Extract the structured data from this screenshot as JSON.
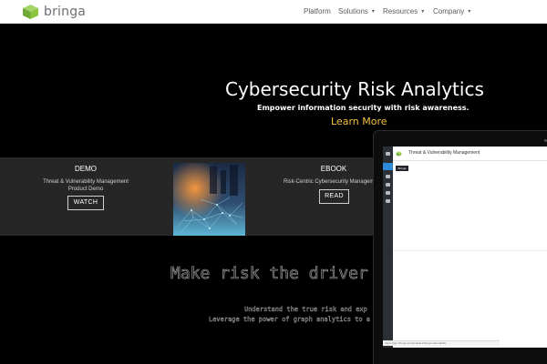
{
  "nav": {
    "logo_text": "bringa",
    "items": [
      {
        "label": "Platform",
        "has_caret": false
      },
      {
        "label": "Solutions",
        "has_caret": true
      },
      {
        "label": "Resources",
        "has_caret": true
      },
      {
        "label": "Company",
        "has_caret": true
      }
    ],
    "caret_glyph": "▾"
  },
  "hero": {
    "title": "Cybersecurity Risk Analytics",
    "subtitle": "Empower information security with risk awareness.",
    "cta": "Learn More",
    "cta_color": "#f5c242"
  },
  "resources": [
    {
      "type": "DEMO",
      "description_line1": "Threat & Vulnerability Management",
      "description_line2": "Product Demo",
      "button": "WATCH"
    },
    {
      "type": "EBOOK",
      "description_line1": "Risk-Centric Cybersecurity Management",
      "description_line2": "",
      "button": "READ"
    }
  ],
  "secondary": {
    "heading": "Make risk the driver for",
    "line1": "Understand the true risk and exp",
    "line2": "Leverage the power of graph analytics to a"
  },
  "device": {
    "app_title": "Threat & Vulnerability Management",
    "tag": "Bringa",
    "status_text": "https://app.bringa.com/analytics/threat-vulnerability"
  },
  "colors": {
    "brand_green": "#8cc63f",
    "accent_blue": "#2f8ad8",
    "band_bg": "#262626"
  }
}
